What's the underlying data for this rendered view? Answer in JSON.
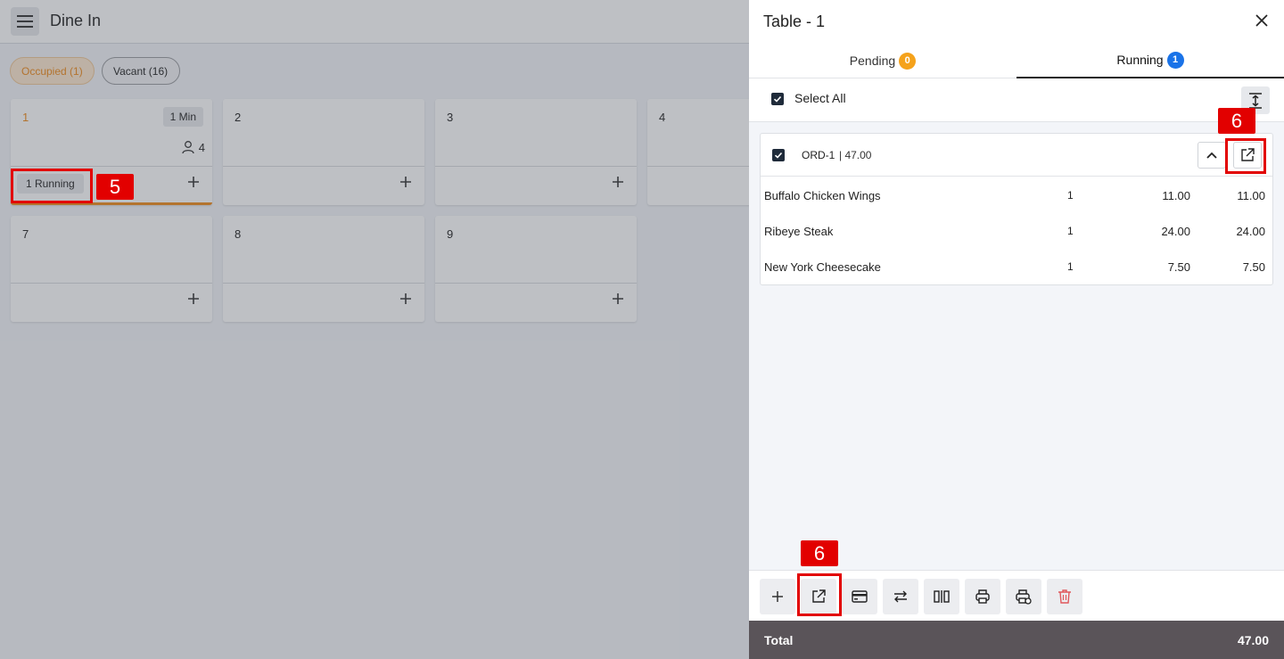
{
  "left": {
    "title": "Dine In",
    "filters": {
      "occupied": "Occupied (1)",
      "vacant": "Vacant (16)"
    },
    "tables": [
      {
        "number": "1",
        "timer": "1 Min",
        "guests": "4",
        "status": "1 Running"
      },
      {
        "number": "2"
      },
      {
        "number": "3"
      },
      {
        "number": "4"
      },
      {
        "number": "7"
      },
      {
        "number": "8"
      },
      {
        "number": "9"
      }
    ]
  },
  "drawer": {
    "title": "Table - 1",
    "tabs": {
      "pending": {
        "label": "Pending",
        "count": "0"
      },
      "running": {
        "label": "Running",
        "count": "1"
      }
    },
    "select_all": "Select All",
    "order": {
      "id": "ORD-1",
      "amount": "| 47.00",
      "items": [
        {
          "name": "Buffalo Chicken Wings",
          "qty": "1",
          "price": "11.00",
          "total": "11.00"
        },
        {
          "name": "Ribeye Steak",
          "qty": "1",
          "price": "24.00",
          "total": "24.00"
        },
        {
          "name": "New York Cheesecake",
          "qty": "1",
          "price": "7.50",
          "total": "7.50"
        }
      ]
    },
    "total_label": "Total",
    "total_value": "47.00"
  },
  "annotations": {
    "step_running": "5",
    "step_move_order": "6",
    "step_move_action": "6"
  },
  "colors": {
    "accent": "#ef8a1b",
    "running_badge": "#1a73e8",
    "pending_badge": "#f5a21b",
    "delete": "#e0575b",
    "annotation": "#e20000"
  }
}
